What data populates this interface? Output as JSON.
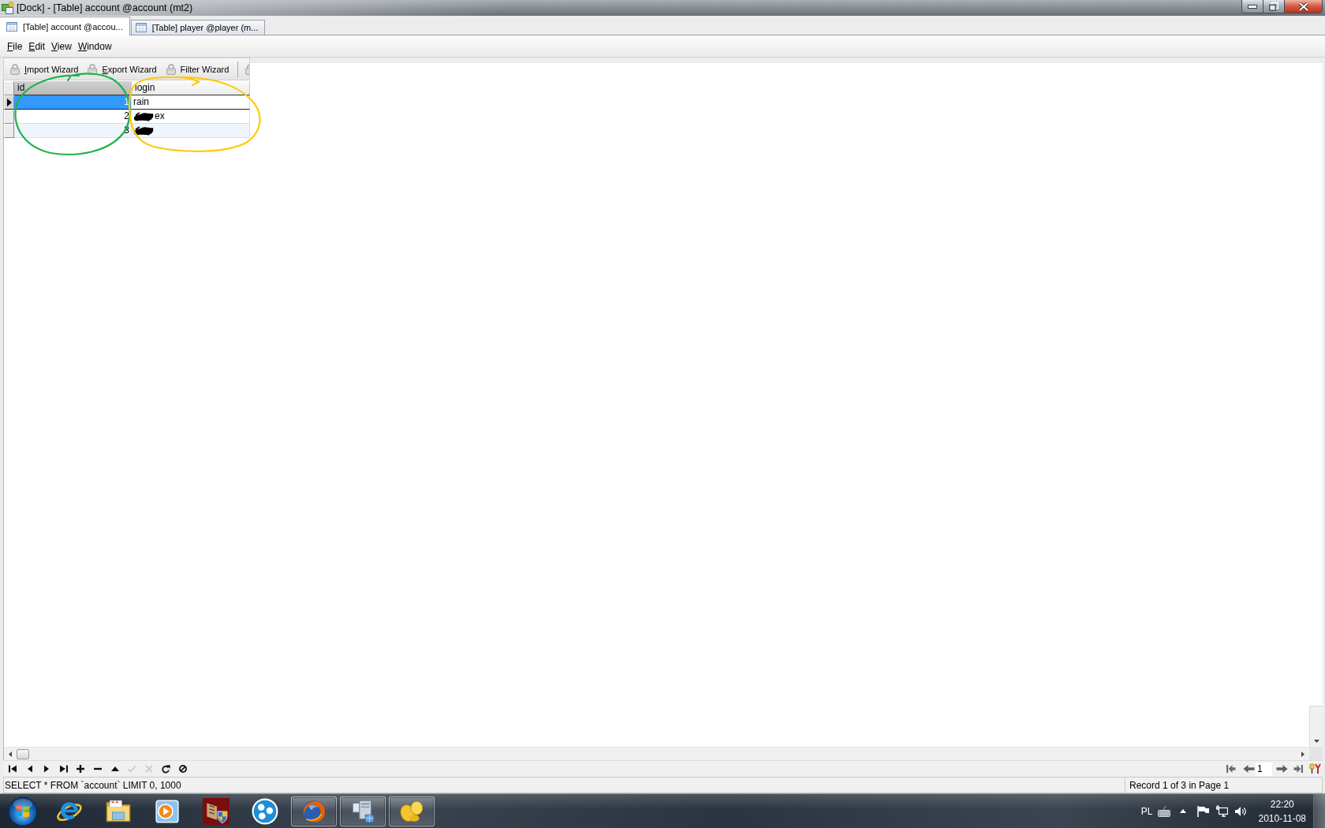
{
  "window": {
    "title": "[Dock] - [Table] account @account (mt2)"
  },
  "tabs": [
    {
      "label": "[Table] account @accou...",
      "selected": true
    },
    {
      "label": "[Table] player @player (m...",
      "selected": false
    }
  ],
  "menu": [
    {
      "key": "F",
      "rest": "ile"
    },
    {
      "key": "E",
      "rest": "dit"
    },
    {
      "key": "V",
      "rest": "iew"
    },
    {
      "key": "W",
      "rest": "indow"
    }
  ],
  "toolbar": {
    "buttons": [
      {
        "key": "I",
        "rest": "mport Wizard"
      },
      {
        "key": "E",
        "rest": "xport Wizard"
      },
      {
        "label": "Filter Wizard"
      }
    ]
  },
  "grid": {
    "columns": [
      {
        "label": "id",
        "selected": true
      },
      {
        "label": "login",
        "selected": false
      }
    ],
    "rows": [
      {
        "id": "1",
        "login": "rain",
        "selected": true,
        "redacted": false
      },
      {
        "id": "2",
        "login": "ex",
        "selected": false,
        "redacted": true
      },
      {
        "id": "3",
        "selected": false,
        "redacted": true
      }
    ]
  },
  "annotations": [
    {
      "color": "#22b14c"
    },
    {
      "color": "#ffc90e"
    }
  ],
  "navigator": {
    "buttons": [
      {
        "kind": "first",
        "disabled": false
      },
      {
        "kind": "prior",
        "disabled": false
      },
      {
        "kind": "next",
        "disabled": false
      },
      {
        "kind": "last",
        "disabled": false
      },
      {
        "kind": "insert",
        "disabled": false
      },
      {
        "kind": "delete",
        "disabled": false
      },
      {
        "kind": "edit",
        "disabled": false
      },
      {
        "kind": "post",
        "disabled": true
      },
      {
        "kind": "cancel",
        "disabled": true
      },
      {
        "kind": "refresh",
        "disabled": false
      },
      {
        "kind": "stop",
        "disabled": false
      }
    ]
  },
  "pager": {
    "page": "1"
  },
  "status_bar": {
    "sql": "SELECT * FROM `account` LIMIT 0, 1000",
    "record": "Record 1 of 3 in Page 1"
  },
  "taskbar": {
    "items": [
      {
        "kind": "browser-e",
        "running": false
      },
      {
        "kind": "folder",
        "running": false
      },
      {
        "kind": "player",
        "running": false
      },
      {
        "kind": "shield-app",
        "running": false
      },
      {
        "kind": "dots",
        "running": false
      },
      {
        "kind": "fox-globe",
        "running": true
      },
      {
        "kind": "computer",
        "running": true
      },
      {
        "kind": "petals",
        "running": true
      }
    ],
    "tray": {
      "language": "PL",
      "time": "22:20",
      "date": "2010-11-08"
    }
  }
}
